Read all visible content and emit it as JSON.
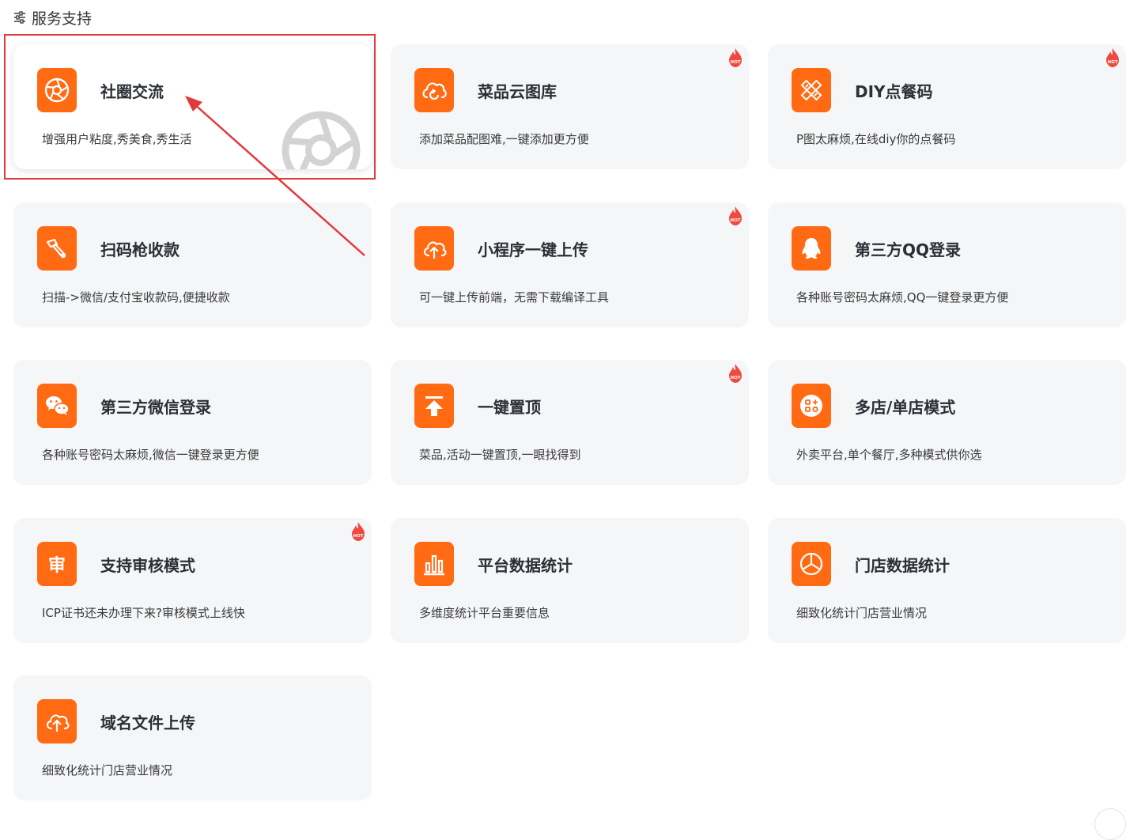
{
  "header": {
    "title": "服务支持",
    "icon": "sliders-icon"
  },
  "colors": {
    "accent": "#ff6a13",
    "card_bg": "#f5f6f8",
    "hot": "#f04a3e",
    "highlight": "#e2393b"
  },
  "cards": [
    {
      "title": "社圈交流",
      "desc": "增强用户粘度,秀美食,秀生活",
      "icon": "aperture-icon",
      "hot": false,
      "active": true
    },
    {
      "title": "菜品云图库",
      "desc": "添加菜品配图难,一键添加更方便",
      "icon": "cloud-refresh-icon",
      "hot": true,
      "active": false
    },
    {
      "title": "DIY点餐码",
      "desc": "P图太麻烦,在线diy你的点餐码",
      "icon": "pencil-ruler-icon",
      "hot": true,
      "active": false
    },
    {
      "title": "扫码枪收款",
      "desc": "扫描->微信/支付宝收款码,便捷收款",
      "icon": "scanner-gun-icon",
      "hot": false,
      "active": false
    },
    {
      "title": "小程序一键上传",
      "desc": "可一键上传前端，无需下载编译工具",
      "icon": "cloud-upload-icon",
      "hot": true,
      "active": false
    },
    {
      "title": "第三方QQ登录",
      "desc": "各种账号密码太麻烦,QQ一键登录更方便",
      "icon": "qq-icon",
      "hot": false,
      "active": false
    },
    {
      "title": "第三方微信登录",
      "desc": "各种账号密码太麻烦,微信一键登录更方便",
      "icon": "wechat-icon",
      "hot": false,
      "active": false
    },
    {
      "title": "一键置顶",
      "desc": "菜品,活动一键置顶,一眼找得到",
      "icon": "pin-top-icon",
      "hot": true,
      "active": false
    },
    {
      "title": "多店/单店模式",
      "desc": "外卖平台,单个餐厅,多种模式供你选",
      "icon": "store-mode-icon",
      "hot": false,
      "active": false
    },
    {
      "title": "支持审核模式",
      "desc": "ICP证书还未办理下来?审核模式上线快",
      "icon": "review-icon",
      "hot": true,
      "active": false
    },
    {
      "title": "平台数据统计",
      "desc": "多维度统计平台重要信息",
      "icon": "bar-chart-icon",
      "hot": false,
      "active": false
    },
    {
      "title": "门店数据统计",
      "desc": "细致化统计门店营业情况",
      "icon": "pie-chart-icon",
      "hot": false,
      "active": false
    },
    {
      "title": "域名文件上传",
      "desc": "细致化统计门店营业情况",
      "icon": "cloud-upload-icon",
      "hot": false,
      "active": false
    }
  ],
  "review_icon_text": "审",
  "hot_label": "HOT"
}
